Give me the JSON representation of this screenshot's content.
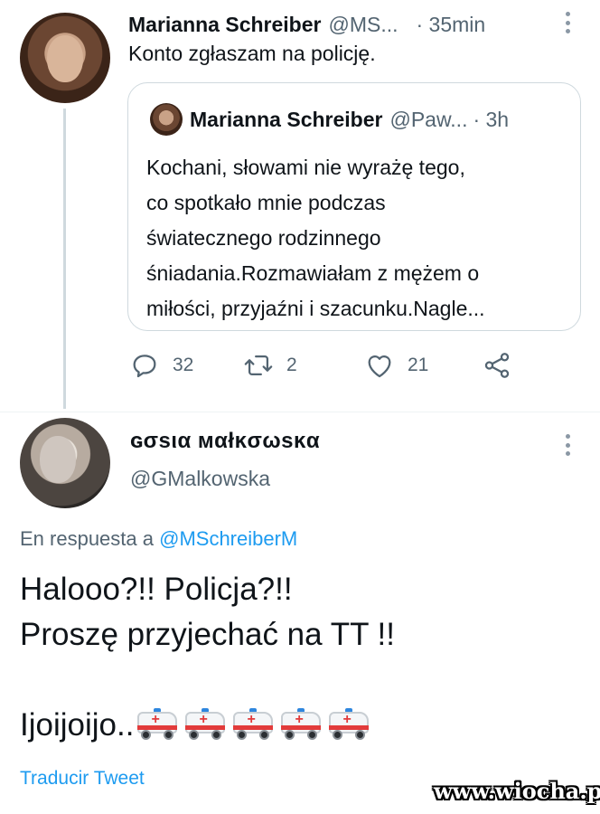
{
  "tweet1": {
    "author_name": "Marianna Schreiber",
    "author_handle": "@MS...",
    "time": "· 35min",
    "text": "Konto zgłaszam na policję.",
    "quoted": {
      "author_name": "Marianna Schreiber",
      "author_handle": "@Paw...",
      "time": "· 3h",
      "lines": [
        "Kochani, słowami nie wyrażę tego,",
        "co spotkało mnie podczas",
        "światecznego rodzinnego",
        "śniadania.Rozmawiałam z mężem o",
        "miłości, przyjaźni i szacunku.Nagle..."
      ]
    },
    "actions": {
      "replies": "32",
      "retweets": "2",
      "likes": "21"
    }
  },
  "tweet2": {
    "author_name": "ɢσѕια мαłĸσωѕĸα",
    "author_handle": "@GMalkowska",
    "reply_prefix": "En respuesta a ",
    "reply_mention": "@MSchreiberM",
    "lines": [
      "Halooo?!! Policja?!!",
      "Proszę przyjechać na TT !!",
      "",
      "Ijoijoijo.."
    ],
    "emoji_count": 5,
    "translate_label": "Traducir Tweet"
  },
  "watermark": "www.wiocha.pl",
  "colors": {
    "text_primary": "#0f1419",
    "text_secondary": "#536471",
    "accent": "#1d9bf0",
    "border": "#cfd9de"
  },
  "icons": {
    "reply": "reply-icon",
    "retweet": "retweet-icon",
    "like": "heart-icon",
    "share": "share-icon",
    "more": "more-vertical-icon",
    "emoji": "ambulance-emoji"
  }
}
